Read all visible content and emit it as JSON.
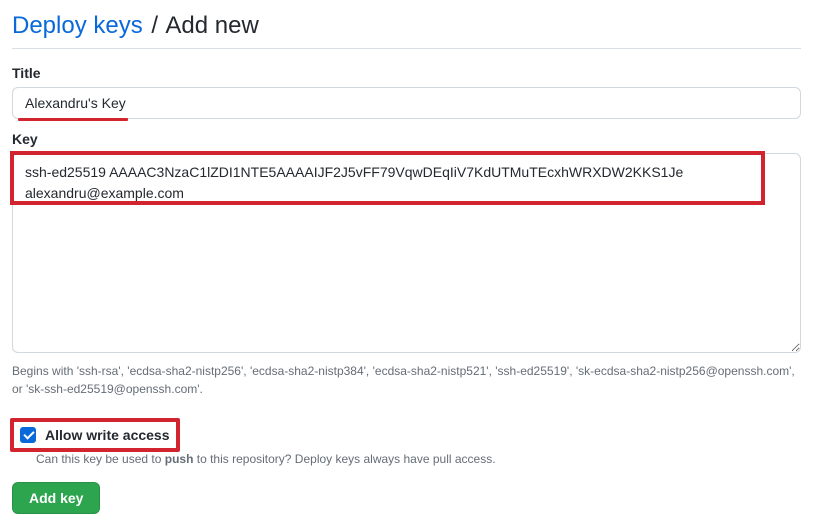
{
  "header": {
    "breadcrumb_link": "Deploy keys",
    "separator": "/",
    "current": "Add new"
  },
  "form": {
    "title_label": "Title",
    "title_value": "Alexandru's Key",
    "key_label": "Key",
    "key_value": "ssh-ed25519 AAAAC3NzaC1lZDI1NTE5AAAAIJF2J5vFF79VqwDEqIiV7KdUTMuTEcxhWRXDW2KKS1Je alexandru@example.com",
    "key_hint": "Begins with 'ssh-rsa', 'ecdsa-sha2-nistp256', 'ecdsa-sha2-nistp384', 'ecdsa-sha2-nistp521', 'ssh-ed25519', 'sk-ecdsa-sha2-nistp256@openssh.com', or 'sk-ssh-ed25519@openssh.com'.",
    "write_access_label": "Allow write access",
    "write_access_hint_pre": "Can this key be used to ",
    "write_access_hint_bold": "push",
    "write_access_hint_post": " to this repository? Deploy keys always have pull access.",
    "submit_label": "Add key"
  }
}
